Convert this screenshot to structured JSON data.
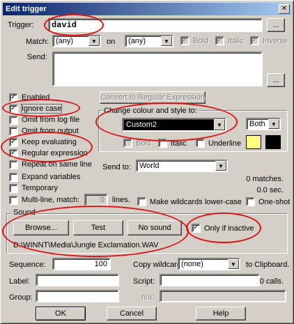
{
  "window": {
    "title": "Edit trigger",
    "close_glyph": "✕"
  },
  "trigger": {
    "label": "Trigger:",
    "value": "david",
    "browse_label": "..."
  },
  "match": {
    "label": "Match:",
    "fore_value": "(any)",
    "on_label": "on",
    "back_value": "(any)",
    "bold_label": "Bold",
    "italic_label": "Italic",
    "inverse_label": "Inverse",
    "bold_checked": true,
    "italic_checked": true,
    "inverse_checked": true
  },
  "send": {
    "label": "Send:",
    "value": "",
    "browse_label": "..."
  },
  "options": {
    "enabled": {
      "label": "Enabled",
      "checked": true
    },
    "ignore_case": {
      "label": "Ignore case",
      "checked": true
    },
    "omit_log": {
      "label": "Omit from log file",
      "checked": false
    },
    "omit_output": {
      "label": "Omit from output",
      "checked": false
    },
    "keep_evaluating": {
      "label": "Keep evaluating",
      "checked": true
    },
    "regular_expression": {
      "label": "Regular expression",
      "checked": true
    },
    "repeat_same_line": {
      "label": "Repeat on same line",
      "checked": false
    },
    "expand_variables": {
      "label": "Expand variables",
      "checked": false
    },
    "temporary": {
      "label": "Temporary",
      "checked": false
    },
    "multi_line": {
      "label": "Multi-line, match:",
      "checked": false,
      "lines_value": "0",
      "lines_label": "lines."
    },
    "lowercase_wildcards": {
      "label": "Make wildcards lower-case",
      "checked": false
    },
    "one_shot": {
      "label": "One-shot",
      "checked": false
    }
  },
  "convert_button": "Convert to Regular Expression",
  "colour": {
    "group_label": "Change colour and style to:",
    "value": "Custom2",
    "both_value": "Both",
    "bold_label": "Bold",
    "italic_label": "Italic",
    "underline_label": "Underline",
    "swatch_fore": "#ffff80",
    "swatch_back": "#000000"
  },
  "send_to": {
    "label": "Send to:",
    "value": "World"
  },
  "stats": {
    "matches": "0 matches.",
    "seconds": "0.0 sec.",
    "calls": "0 calls."
  },
  "sound": {
    "group_label": "Sound",
    "browse_button": "Browse...",
    "test_button": "Test",
    "no_sound_button": "No sound",
    "only_inactive_label": "Only if inactive",
    "only_inactive_checked": true,
    "path": "D:\\WINNT\\Media\\Jungle Exclamation.WAV"
  },
  "sequence": {
    "label": "Sequence:",
    "value": "100"
  },
  "copy_wildcard": {
    "label": "Copy wildcard:",
    "value": "(none)",
    "suffix": "to Clipboard."
  },
  "label_field": {
    "label": "Label:",
    "value": ""
  },
  "script_field": {
    "label": "Script:",
    "value": ""
  },
  "group_field": {
    "label": "Group:",
    "value": ""
  },
  "na_field": {
    "label": "n/a:",
    "value": ""
  },
  "buttons": {
    "ok": "OK",
    "cancel": "Cancel",
    "help": "Help"
  },
  "colors": {
    "annotation": "#e01010",
    "dialog_face": "#d4d0c8",
    "title_bar": "#0a246a"
  }
}
